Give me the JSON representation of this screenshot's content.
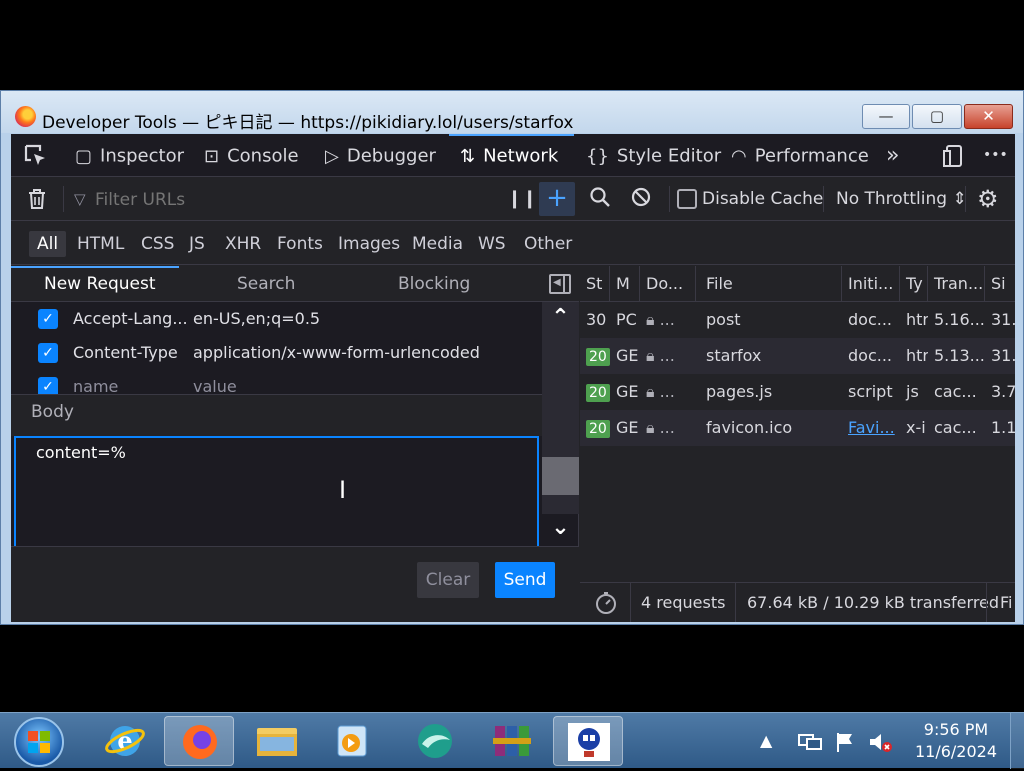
{
  "window": {
    "title": "Developer Tools — ピキ日記 — https://pikidiary.lol/users/starfox",
    "minimize": "—",
    "maximize": "▢",
    "close": "✕"
  },
  "toolbar": {
    "tabs": [
      {
        "label": "Inspector",
        "icon": "inspector-icon"
      },
      {
        "label": "Console",
        "icon": "console-icon"
      },
      {
        "label": "Debugger",
        "icon": "debugger-icon"
      },
      {
        "label": "Network",
        "icon": "network-icon"
      },
      {
        "label": "Style Editor",
        "icon": "style-editor-icon"
      },
      {
        "label": "Performance",
        "icon": "performance-icon"
      }
    ],
    "overflow": "»",
    "more": "•••"
  },
  "filterbar": {
    "placeholder": "Filter URLs",
    "disable_cache": "Disable Cache",
    "throttling": "No Throttling ⇕"
  },
  "type_filters": [
    "All",
    "HTML",
    "CSS",
    "JS",
    "XHR",
    "Fonts",
    "Images",
    "Media",
    "WS",
    "Other"
  ],
  "request_panel": {
    "tabs": [
      "New Request",
      "Search",
      "Blocking"
    ],
    "headers": [
      {
        "name": "Accept-Lang...",
        "value": "en-US,en;q=0.5"
      },
      {
        "name": "Content-Type",
        "value": "application/x-www-form-urlencoded"
      }
    ],
    "new_header": {
      "name": "name",
      "value": "value"
    },
    "body_label": "Body",
    "body_value": "content=%",
    "clear": "Clear",
    "send": "Send"
  },
  "list": {
    "columns": [
      "St",
      "M",
      "Do...",
      "File",
      "Initi...",
      "Ty",
      "Tran...",
      "Si"
    ],
    "rows": [
      {
        "status": "30",
        "method": "PC",
        "file": "post",
        "initiator": "doc...",
        "type": "htr",
        "transferred": "5.16...",
        "size": "31."
      },
      {
        "status": "20",
        "method": "GE",
        "file": "starfox",
        "initiator": "doc...",
        "type": "htr",
        "transferred": "5.13...",
        "size": "31."
      },
      {
        "status": "20",
        "method": "GE",
        "file": "pages.js",
        "initiator": "script",
        "type": "js",
        "transferred": "cac...",
        "size": "3.7"
      },
      {
        "status": "20",
        "method": "GE",
        "file": "favicon.ico",
        "initiator": "Favi...",
        "type": "x-i",
        "transferred": "cac...",
        "size": "1.1"
      }
    ],
    "footer": {
      "requests": "4 requests",
      "transferred": "67.64 kB / 10.29 kB transferred",
      "finish": "Fi"
    }
  },
  "taskbar": {
    "time": "9:56 PM",
    "date": "11/6/2024"
  },
  "colors": {
    "accent": "#0a84ff",
    "status_ok": "#4ea04f",
    "panel_bg": "#1c1b22"
  }
}
